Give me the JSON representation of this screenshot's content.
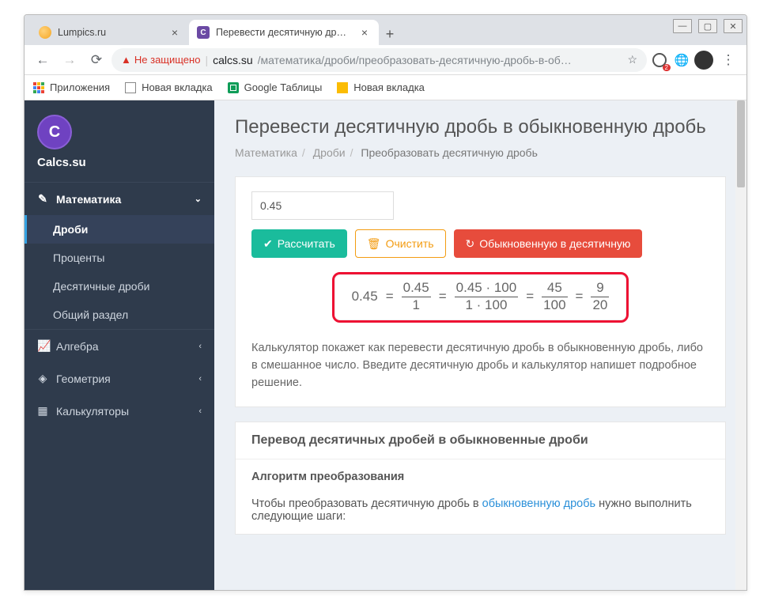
{
  "window_controls": {
    "min": "—",
    "max": "▢",
    "close": "✕"
  },
  "tabs": [
    {
      "title": "Lumpics.ru"
    },
    {
      "title": "Перевести десятичную дробь в",
      "badge": "С"
    }
  ],
  "toolbar": {
    "insecure_label": "Не защищено",
    "url_host": "calcs.su",
    "url_rest": "/математика/дроби/преобразовать-десятичную-дробь-в-об…"
  },
  "bookmarks": {
    "apps": "Приложения",
    "items": [
      "Новая вкладка",
      "Google Таблицы",
      "Новая вкладка"
    ]
  },
  "sidebar": {
    "logo": "C",
    "site": "Calcs.su",
    "math": "Математика",
    "sub": [
      "Дроби",
      "Проценты",
      "Десятичные дроби",
      "Общий раздел"
    ],
    "algebra": "Алгебра",
    "geometry": "Геометрия",
    "calc": "Калькуляторы"
  },
  "page": {
    "title": "Перевести десятичную дробь в обыкновенную дробь",
    "crumbs": [
      "Математика",
      "Дроби",
      "Преобразовать десятичную дробь"
    ]
  },
  "form": {
    "value": "0.45",
    "calc": "Рассчитать",
    "clear": "Очистить",
    "swap": "Обыкновенную в десятичную"
  },
  "result": {
    "start": "0.45",
    "steps": [
      {
        "n": "0.45",
        "d": "1"
      },
      {
        "n": "0.45 · 100",
        "d": "1 · 100"
      },
      {
        "n": "45",
        "d": "100"
      },
      {
        "n": "9",
        "d": "20"
      }
    ]
  },
  "desc": "Калькулятор покажет как перевести десятичную дробь в обыкновенную дробь, либо в смешанное число. Введите десятичную дробь и калькулятор напишет подробное решение.",
  "section1_h": "Перевод десятичных дробей в обыкновенные дроби",
  "section2_h": "Алгоритм преобразования",
  "section2_p1": "Чтобы преобразовать десятичную дробь в ",
  "section2_link": "обыкновенную дробь",
  "section2_p2": " нужно выполнить следующие шаги:"
}
